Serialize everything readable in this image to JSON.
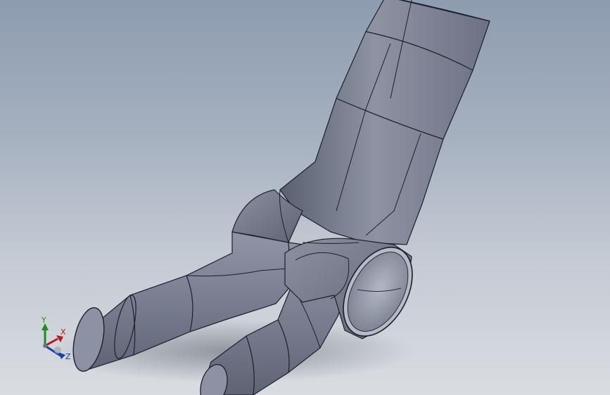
{
  "viewport": {
    "background_top": "#8d9cb0",
    "background_bottom": "#d9dde2"
  },
  "model": {
    "part_color": "#7d8294",
    "edge_color": "#1c1f2a"
  },
  "triad": {
    "y_label": "Y",
    "x_label": "X",
    "z_label": "Z",
    "y_color": "#1e8b1e",
    "x_color": "#c0141e",
    "z_color": "#1a3fa6"
  }
}
